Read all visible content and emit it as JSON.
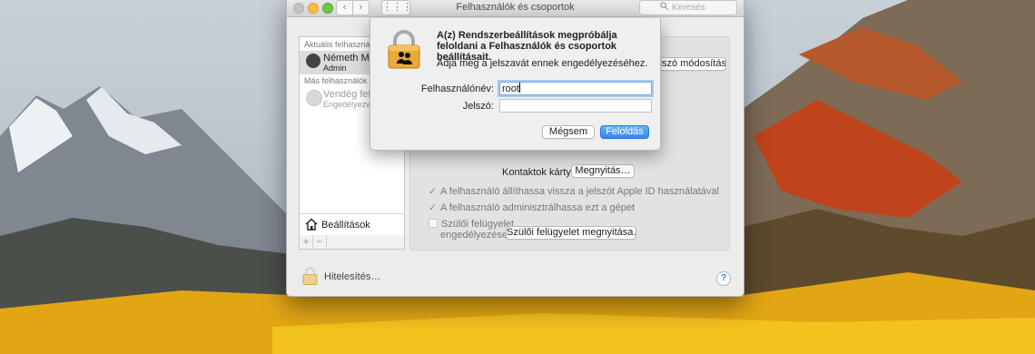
{
  "window": {
    "title": "Felhasználók és csoportok",
    "search_placeholder": "Keresés",
    "nav_back": "‹",
    "nav_forward": "›",
    "grid_glyph": "⋮⋮⋮"
  },
  "sidebar": {
    "current_users_label": "Aktuális felhasználó",
    "current_user": {
      "name": "Németh Mária",
      "role": "Admin"
    },
    "other_users_label": "Más felhasználók",
    "other_user": {
      "name": "Vendég felhasználó",
      "status": "Engedélyezve, csak megosztás"
    },
    "settings_label": "Beállítások",
    "add": "+",
    "remove": "−"
  },
  "panel": {
    "change_button": "Jelszó módosítása…",
    "contacts_label": "Kontaktok kártya:",
    "open_button": "Megnyitás…",
    "check_apple_id": "A felhasználó állíthassa vissza a jelszót Apple ID használatával",
    "check_admin": "A felhasználó adminisztrálhassa ezt a gépet",
    "parental_line1": "Szülői felügyelet",
    "parental_line2": "engedélyezése",
    "parental_button": "Szülői felügyelet megnyitása…"
  },
  "footer": {
    "lock_label": "Hitelesítés…",
    "help": "?"
  },
  "dialog": {
    "title": "A(z) Rendszerbeállítások megpróbálja feloldani a Felhasználók és csoportok beállításait.",
    "message": "Adja meg a jelszavát ennek engedélyezéséhez.",
    "username_label": "Felhasználónév:",
    "username_value": "root",
    "password_label": "Jelszó:",
    "password_value": "",
    "cancel": "Mégsem",
    "unlock": "Feloldás"
  },
  "colors": {
    "accent": "#2f86f0",
    "focus_ring": "#a8c8f2"
  },
  "icons": [
    "search-icon",
    "padlock-users-icon",
    "house-icon",
    "padlock-icon",
    "checkmark-icon"
  ]
}
